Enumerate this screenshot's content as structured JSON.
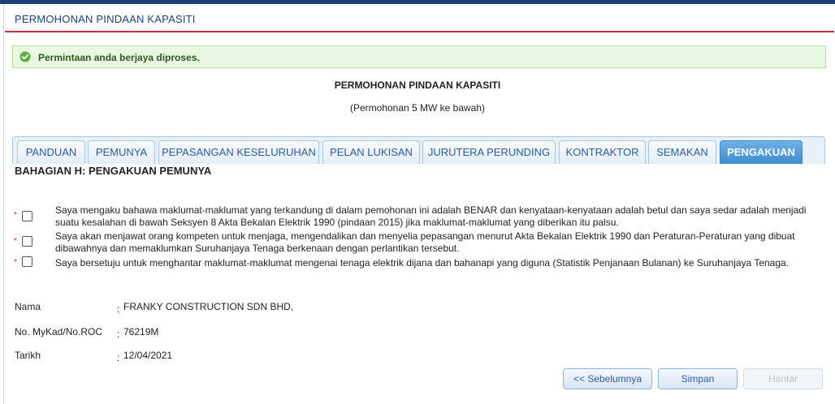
{
  "header": {
    "title": "PERMOHONAN PINDAAN KAPASITI"
  },
  "alert": {
    "message": "Permintaan anda berjaya diproses.",
    "color": "#2c5a1c"
  },
  "form": {
    "title": "PERMOHONAN PINDAAN KAPASITI",
    "subtitle": "(Permohonan 5 MW ke bawah)"
  },
  "tabs": [
    {
      "label": "PANDUAN",
      "active": false
    },
    {
      "label": "PEMUNYA",
      "active": false
    },
    {
      "label": "PEPASANGAN KESELURUHAN",
      "active": false
    },
    {
      "label": "PELAN LUKISAN",
      "active": false
    },
    {
      "label": "JURUTERA PERUNDING",
      "active": false
    },
    {
      "label": "KONTRAKTOR",
      "active": false
    },
    {
      "label": "SEMAKAN",
      "active": false
    },
    {
      "label": "PENGAKUAN",
      "active": true
    }
  ],
  "section": {
    "title": "BAHAGIAN H: PENGAKUAN PEMUNYA"
  },
  "declarations": [
    {
      "required_mark": "*",
      "checked": false,
      "text_line1": "Saya mengaku bahawa maklumat-maklumat yang terkandung di dalam pemohonan ini adalah BENAR dan kenyataan-kenyataan adalah betul dan saya sedar adalah menjadi",
      "text_line2": "suatu kesalahan di bawah Seksyen 8 Akta Bekalan Elektrik 1990 (pindaan 2015) jika maklumat-maklumat yang diberikan itu palsu."
    },
    {
      "required_mark": "*",
      "checked": false,
      "text_line1": "Saya akan menjawat orang kompeten untuk menjaga, mengendalikan dan menyelia pepasangan menurut Akta Bekalan Elektrik 1990 dan Peraturan-Peraturan yang dibuat",
      "text_line2": "dibawahnya dan memaklumkan Suruhanjaya Tenaga berkenaan dengan perlantikan tersebut."
    },
    {
      "required_mark": "*",
      "checked": false,
      "text_line1": "Saya bersetuju untuk menghantar maklumat-maklumat mengenai tenaga elektrik dijana dan bahanapi yang diguna (Statistik Penjanaan Bulanan) ke Suruhanjaya Tenaga.",
      "text_line2": ""
    }
  ],
  "info": {
    "colon": ":",
    "nama_label": "Nama",
    "nama_value": "FRANKY CONSTRUCTION SDN BHD,",
    "roc_label": "No. MyKad/No.ROC",
    "roc_value": "76219M",
    "tarikh_label": "Tarikh",
    "tarikh_value": "12/04/2021"
  },
  "buttons": {
    "prev": "<< Sebelumnya",
    "save": "Simpan",
    "submit": "Hantar"
  },
  "colors": {
    "accent": "#1f3f7a",
    "header_rule": "#c0303a",
    "tab_active": "#3f8ccf",
    "required": "#d0303a"
  }
}
